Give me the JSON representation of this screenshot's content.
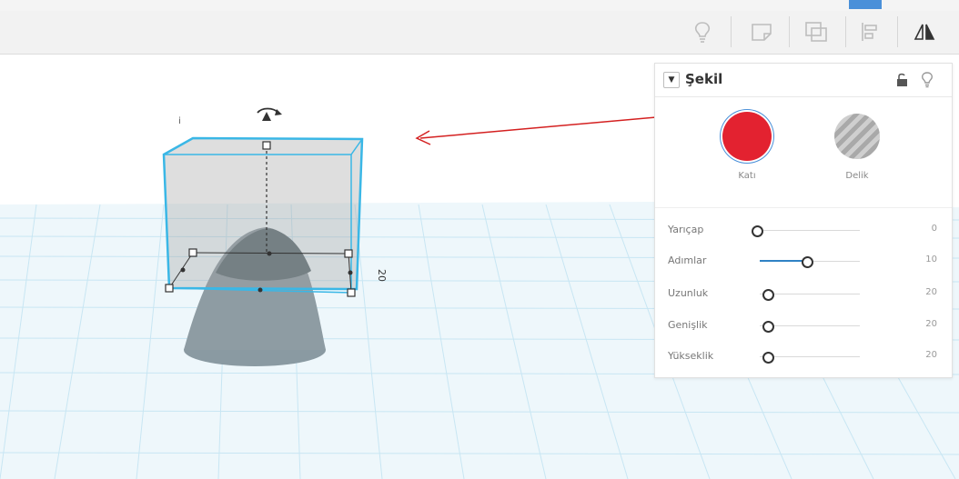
{
  "panel": {
    "title": "Şekil",
    "color_options": [
      {
        "label": "Katı",
        "color": "#e32230"
      },
      {
        "label": "Delik",
        "color": "#bdbdbd"
      }
    ],
    "properties": [
      {
        "label": "Yarıçap",
        "value": "0"
      },
      {
        "label": "Adımlar",
        "value": "10"
      },
      {
        "label": "Uzunluk",
        "value": "20"
      },
      {
        "label": "Genişlik",
        "value": "20"
      },
      {
        "label": "Yükseklik",
        "value": "20"
      }
    ]
  },
  "toolbar": {
    "icons": [
      "lightbulb-icon",
      "note-icon",
      "layers-icon",
      "align-icon",
      "mirror-icon"
    ]
  },
  "canvas": {
    "dimension_label": "20",
    "annotation_arrow_color": "#d42020",
    "selection_color": "#3ab7e6",
    "grid_color": "#bfe3f2"
  }
}
